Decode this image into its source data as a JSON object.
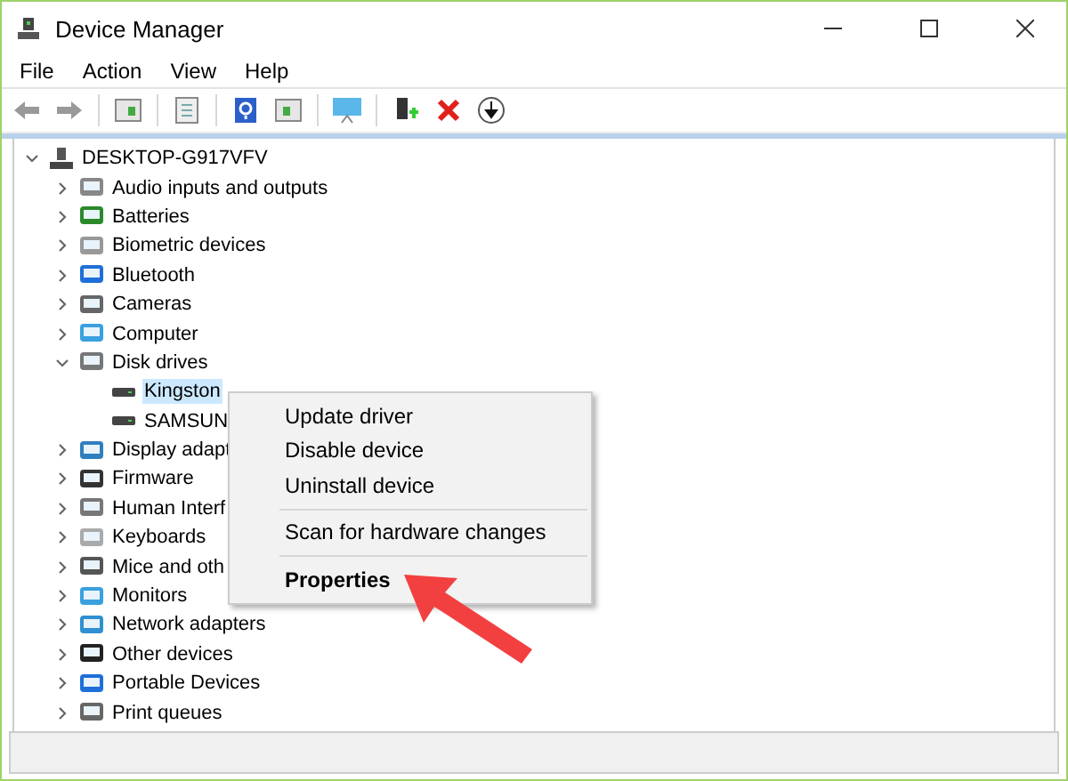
{
  "window": {
    "title": "Device Manager"
  },
  "menu_bar": [
    "File",
    "Action",
    "View",
    "Help"
  ],
  "tree": {
    "label": "DESKTOP-G917VFV",
    "expanded": true,
    "children": [
      {
        "label": "Audio inputs and outputs",
        "expanded": false
      },
      {
        "label": "Batteries",
        "expanded": false
      },
      {
        "label": "Biometric devices",
        "expanded": false
      },
      {
        "label": "Bluetooth",
        "expanded": false
      },
      {
        "label": "Cameras",
        "expanded": false
      },
      {
        "label": "Computer",
        "expanded": false
      },
      {
        "label": "Disk drives",
        "expanded": true,
        "children": [
          {
            "label": "Kingston",
            "selected": true
          },
          {
            "label": "SAMSUN",
            "selected": false
          }
        ]
      },
      {
        "label": "Display adapt",
        "expanded": false
      },
      {
        "label": "Firmware",
        "expanded": false
      },
      {
        "label": "Human Interf",
        "expanded": false
      },
      {
        "label": "Keyboards",
        "expanded": false
      },
      {
        "label": "Mice and oth",
        "expanded": false
      },
      {
        "label": "Monitors",
        "expanded": false
      },
      {
        "label": "Network adapters",
        "expanded": false
      },
      {
        "label": "Other devices",
        "expanded": false
      },
      {
        "label": "Portable Devices",
        "expanded": false
      },
      {
        "label": "Print queues",
        "expanded": false
      }
    ]
  },
  "context_menu": {
    "groups": [
      [
        {
          "label": "Update driver",
          "default": false
        },
        {
          "label": "Disable device",
          "default": false
        },
        {
          "label": "Uninstall device",
          "default": false
        }
      ],
      [
        {
          "label": "Scan for hardware changes",
          "default": false
        }
      ],
      [
        {
          "label": "Properties",
          "default": true
        }
      ]
    ]
  }
}
